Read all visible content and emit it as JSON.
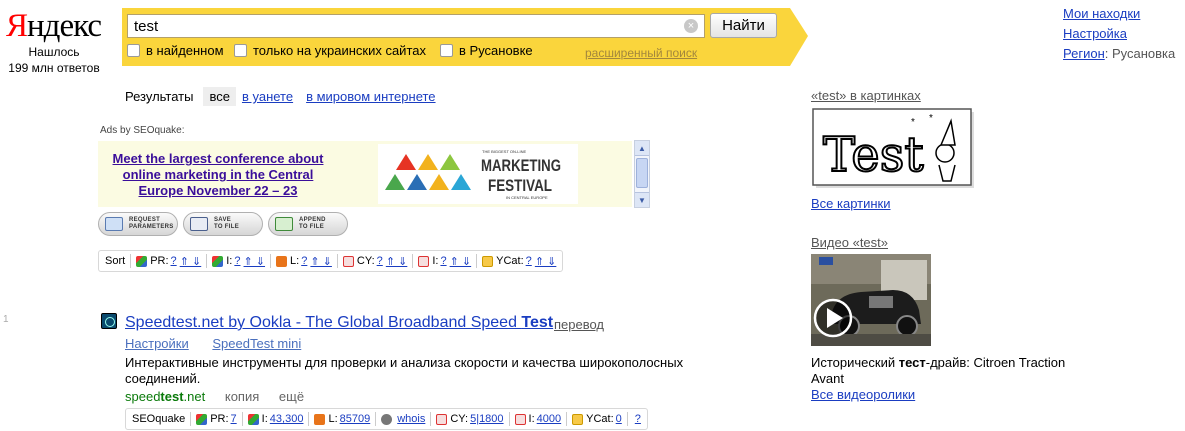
{
  "logo": {
    "first": "Я",
    "rest": "ндекс"
  },
  "found": {
    "line1": "Нашлось",
    "line2": "199 млн ответов"
  },
  "search": {
    "value": "test",
    "button": "Найти",
    "clear": "×",
    "options": [
      "в найденном",
      "только на украинских сайтах",
      "в Русановке"
    ],
    "advanced": "расширенный поиск"
  },
  "top_right": {
    "my_finds": "Мои находки",
    "settings": "Настройка",
    "region_label": "Регион",
    "region_value": ": Русановка"
  },
  "tabs": {
    "label": "Результаты",
    "all": "все",
    "uanet": "в уанете",
    "world": "в мировом интернете"
  },
  "ads": {
    "label": "Ads by SEOquake:",
    "text": "Meet the largest conference about online marketing in the Central Europe November 22 – 23",
    "banner_top": "THE BIGGEST ON-LINE",
    "banner_main1": "MARKETING",
    "banner_main2": "FESTIVAL",
    "banner_bottom": "IN CENTRAL EUROPE"
  },
  "sq_buttons": [
    {
      "line1": "REQUEST",
      "line2": "PARAMETERS"
    },
    {
      "line1": "SAVE",
      "line2": "TO FILE"
    },
    {
      "line1": "APPEND",
      "line2": "TO FILE"
    }
  ],
  "sort_bar": {
    "sort": "Sort",
    "pr": "PR:",
    "i": "I:",
    "l": "L:",
    "cy": "CY:",
    "i2": "I:",
    "ycat": "YCat:",
    "q": "?",
    "arrows": "⇑ ⇓"
  },
  "result": {
    "number": "1",
    "title_pre": "Speedtest.net by Ookla - The Global Broadband Speed ",
    "title_bold": "Test",
    "translate": "перевод",
    "sitelinks": [
      "Настройки",
      "SpeedTest mini"
    ],
    "snippet": "Интерактивные инструменты для проверки и анализа скорости и качества широкополосных соединений.",
    "url_pre": "speed",
    "url_bold": "test",
    "url_post": ".net",
    "copy": "копия",
    "more": "ещё"
  },
  "result_bar": {
    "name": "SEOquake",
    "pr": "PR:",
    "pr_v": "7",
    "i": "I:",
    "i_v": "43,300",
    "l": "L:",
    "l_v": "85709",
    "whois": "whois",
    "cy": "CY:",
    "cy_v": "5|1800",
    "i2": "I:",
    "i2_v": "4000",
    "ycat": "YCat:",
    "ycat_v": "0",
    "q": "?"
  },
  "right": {
    "images_head": "«test» в картинках",
    "images_word": "Test",
    "all_images": "Все картинки",
    "video_head": "Видео «test»",
    "video_caption_pre": "Исторический ",
    "video_caption_bold": "тест",
    "video_caption_post": "-драйв: Citroen Traction Avant",
    "all_videos": "Все видеоролики"
  }
}
